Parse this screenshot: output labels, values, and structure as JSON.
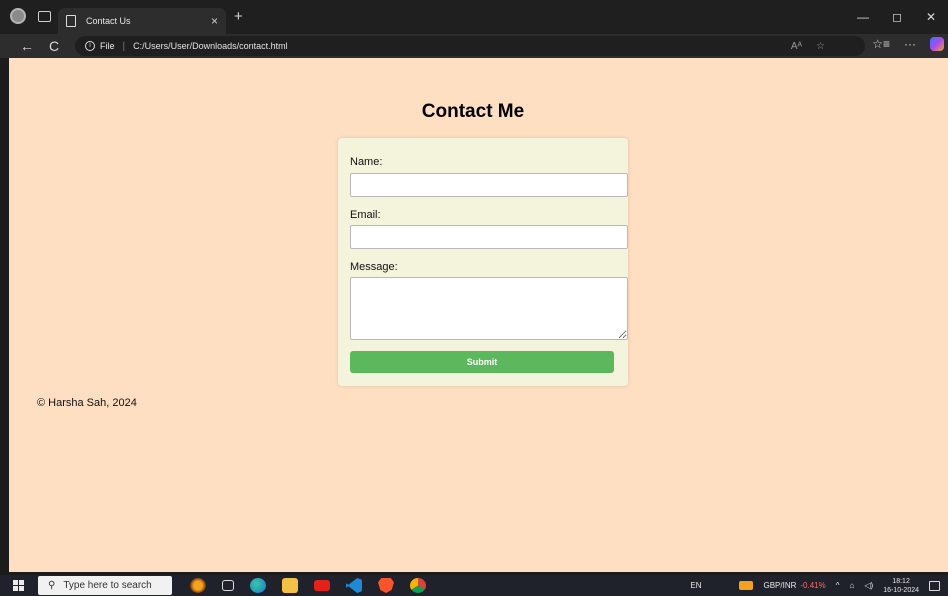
{
  "browser": {
    "tab_title": "Contact Us",
    "tab_close": "×",
    "new_tab": "+",
    "win_minimize": "—",
    "win_restore": "◻",
    "win_close": "✕",
    "back": "←",
    "refresh": "C",
    "site_label": "File",
    "url": "C:/Users/User/Downloads/contact.html",
    "read_aloud": "Aᴬ",
    "favorite": "☆",
    "favorites_list": "☆≡",
    "more": "···"
  },
  "page": {
    "heading": "Contact Me",
    "form": {
      "name_label": "Name:",
      "name_value": "",
      "email_label": "Email:",
      "email_value": "",
      "message_label": "Message:",
      "message_value": "",
      "submit_label": "Submit"
    },
    "footer": "© Harsha Sah, 2024"
  },
  "taskbar": {
    "search_placeholder": "Type here to search",
    "language": "EN",
    "ticker_name": "GBP/INR",
    "ticker_change": "-0.41%",
    "tray_chevron": "^",
    "time": "18:12",
    "date": "16-10-2024"
  },
  "colors": {
    "page_bg": "#ffdfc2",
    "card_bg": "#f4f3dc",
    "submit_bg": "#5cb85c"
  }
}
